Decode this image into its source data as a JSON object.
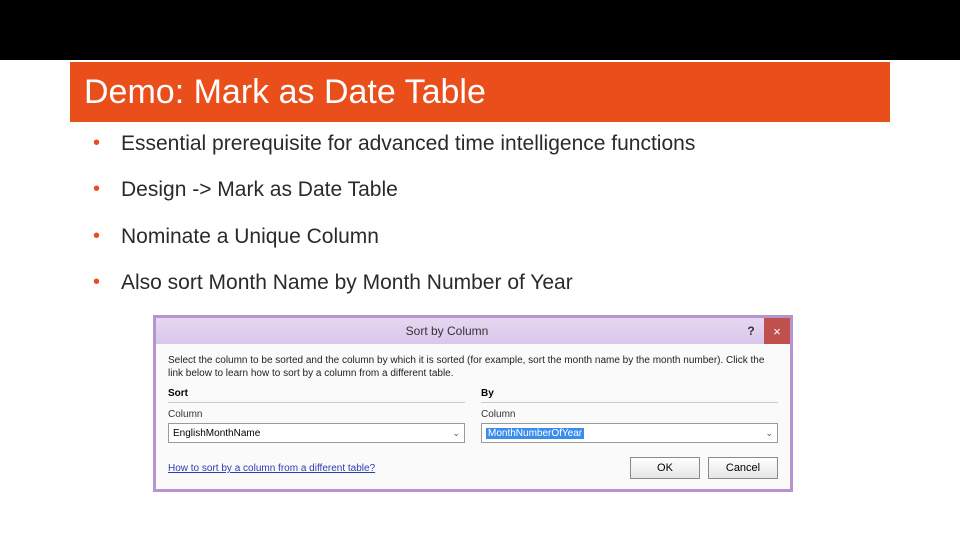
{
  "title": "Demo: Mark as Date Table",
  "bullets": [
    "Essential prerequisite for advanced time intelligence functions",
    "Design -> Mark as Date Table",
    "Nominate a Unique Column",
    "Also sort Month Name by Month Number of Year"
  ],
  "dialog": {
    "title": "Sort by Column",
    "help": "?",
    "close": "×",
    "instruction": "Select the column to be sorted and the column by which it is sorted (for example, sort the month name by the month number). Click the link below to learn how to sort by a column from a different table.",
    "sort_group": "Sort",
    "by_group": "By",
    "column_label": "Column",
    "sort_value": "EnglishMonthName",
    "by_value": "MonthNumberOfYear",
    "link": "How to sort by a column from a different table?",
    "ok": "OK",
    "cancel": "Cancel"
  }
}
